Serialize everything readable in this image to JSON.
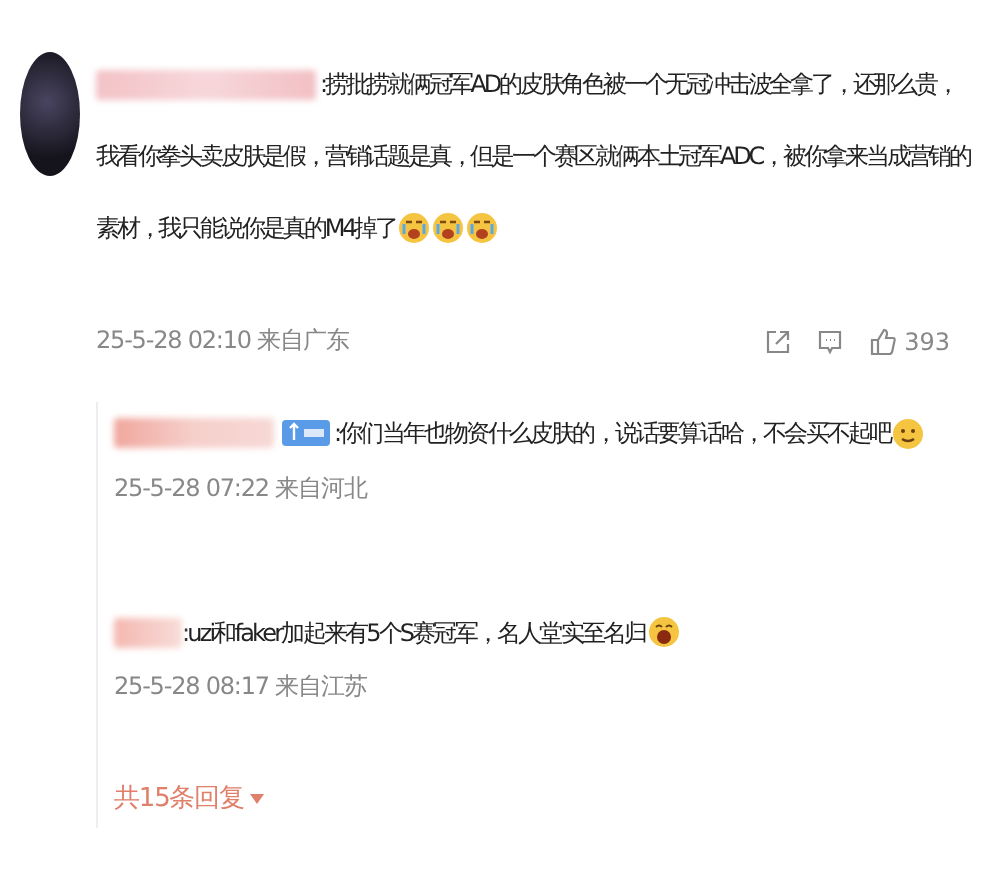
{
  "comment": {
    "lines": [
      ":捞批捞就俩冠军AD的皮肤角色被一个无冠冲击波全拿了，还那么贵，",
      "我看你拳头卖皮肤是假，营销话题是真，但是一个赛区就俩本土冠军ADC，被你拿来当成营销的",
      "素材，我只能说你是真的M4掉了"
    ],
    "emojis": [
      {
        "kind": "crying"
      },
      {
        "kind": "crying"
      },
      {
        "kind": "crying"
      }
    ],
    "time": "25-5-28 02:10 来自广东",
    "likes": "393"
  },
  "replies": [
    {
      "badge": true,
      "text": ":你们当年也物资什么皮肤的，说话要算话哈，不会买不起吧",
      "emojis": [
        {
          "kind": "smirk"
        }
      ],
      "time": "25-5-28 07:22 来自河北"
    },
    {
      "badge": false,
      "text": ":uzi和faker加起来有5个S赛冠军，名人堂实至名归",
      "emojis": [
        {
          "kind": "laughing"
        }
      ],
      "time": "25-5-28 08:17 来自江苏"
    }
  ],
  "more_replies": "共15条回复"
}
